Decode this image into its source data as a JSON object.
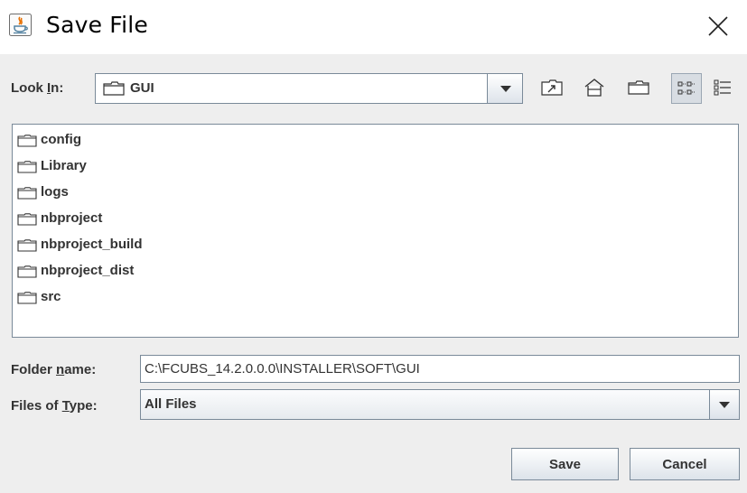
{
  "window": {
    "title": "Save File"
  },
  "look_in": {
    "label_prefix": "Look ",
    "label_mnemonic": "I",
    "label_suffix": "n:",
    "value": "GUI"
  },
  "toolbar": {
    "buttons": [
      "up-one-level-icon",
      "home-icon",
      "new-folder-icon",
      "list-view-icon",
      "details-view-icon"
    ],
    "selected_view": "list"
  },
  "files": [
    {
      "name": "config",
      "icon": "folder-icon"
    },
    {
      "name": "Library",
      "icon": "folder-icon"
    },
    {
      "name": "logs",
      "icon": "folder-icon"
    },
    {
      "name": "nbproject",
      "icon": "folder-icon"
    },
    {
      "name": "nbproject_build",
      "icon": "folder-icon"
    },
    {
      "name": "nbproject_dist",
      "icon": "folder-icon"
    },
    {
      "name": "src",
      "icon": "folder-icon"
    }
  ],
  "folder_name": {
    "label_prefix": "Folder ",
    "label_mnemonic": "n",
    "label_suffix": "ame:",
    "value": "C:\\FCUBS_14.2.0.0.0\\INSTALLER\\SOFT\\GUI"
  },
  "files_of_type": {
    "label_prefix": "Files of ",
    "label_mnemonic": "T",
    "label_suffix": "ype:",
    "value": "All Files"
  },
  "buttons": {
    "save": "Save",
    "cancel": "Cancel"
  }
}
